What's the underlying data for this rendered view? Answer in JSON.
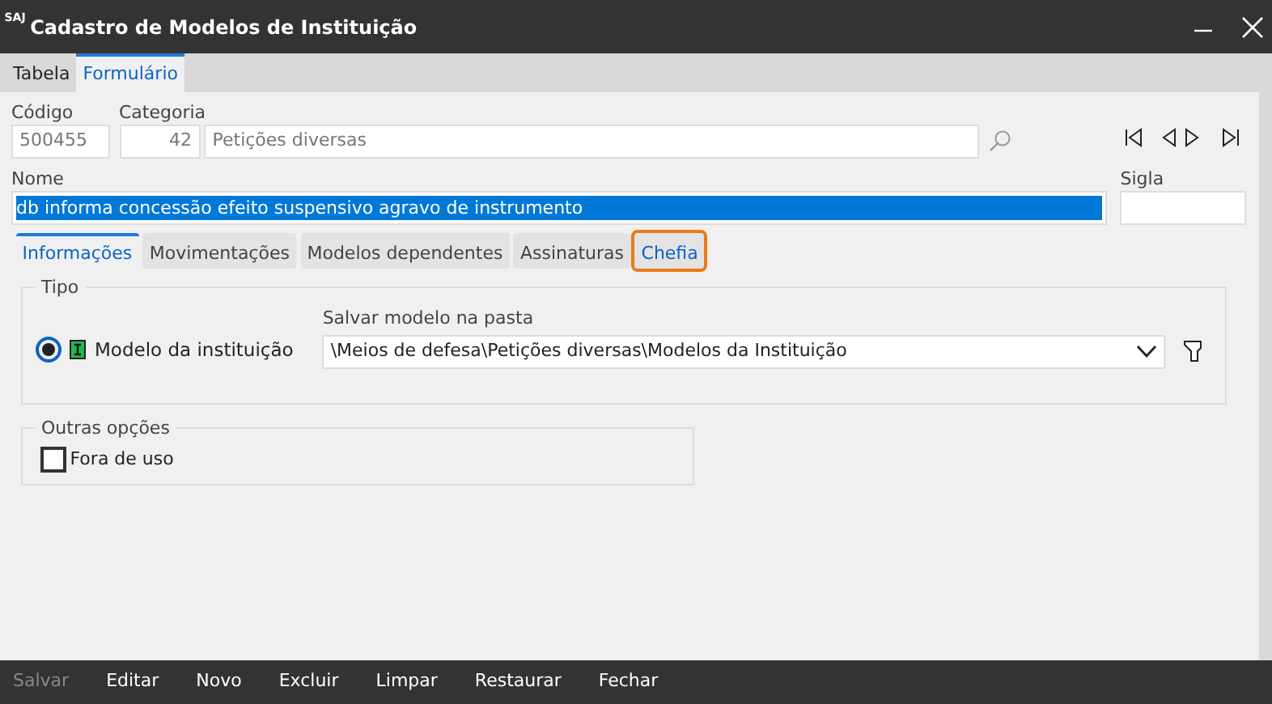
{
  "window": {
    "title": "Cadastro de Modelos de Instituição",
    "app_mark": "SAJ"
  },
  "view_tabs": [
    {
      "label": "Tabela",
      "selected": false
    },
    {
      "label": "Formulário",
      "selected": true
    }
  ],
  "codigo": {
    "label": "Código",
    "value": "500455"
  },
  "categoria": {
    "label": "Categoria",
    "number": "42",
    "name": "Petições diversas"
  },
  "nome": {
    "label": "Nome",
    "value": "db informa concessão efeito suspensivo agravo de instrumento",
    "text_selected": true
  },
  "sigla": {
    "label": "Sigla"
  },
  "section_tabs": [
    {
      "label": "Informações",
      "selected": true,
      "focused": false
    },
    {
      "label": "Movimentações",
      "selected": false,
      "focused": false
    },
    {
      "label": "Modelos dependentes",
      "selected": false,
      "focused": false
    },
    {
      "label": "Assinaturas",
      "selected": false,
      "focused": false
    },
    {
      "label": "Chefia",
      "selected": false,
      "focused": true
    }
  ],
  "tipo": {
    "title": "Tipo",
    "options": [
      {
        "label": "Modelo da instituição",
        "selected": true
      }
    ],
    "folder_label": "Salvar modelo na pasta",
    "folder_value": "\\Meios de defesa\\Petições diversas\\Modelos da Instituição"
  },
  "outras_opcoes": {
    "title": "Outras opções",
    "checkboxes": [
      {
        "label": "Fora de uso",
        "checked": false
      }
    ]
  },
  "actions": [
    {
      "label": "Salvar",
      "disabled": true
    },
    {
      "label": "Editar",
      "disabled": false
    },
    {
      "label": "Novo",
      "disabled": false
    },
    {
      "label": "Excluir",
      "disabled": false
    },
    {
      "label": "Limpar",
      "disabled": false
    },
    {
      "label": "Restaurar",
      "disabled": false
    },
    {
      "label": "Fechar",
      "disabled": false
    }
  ]
}
